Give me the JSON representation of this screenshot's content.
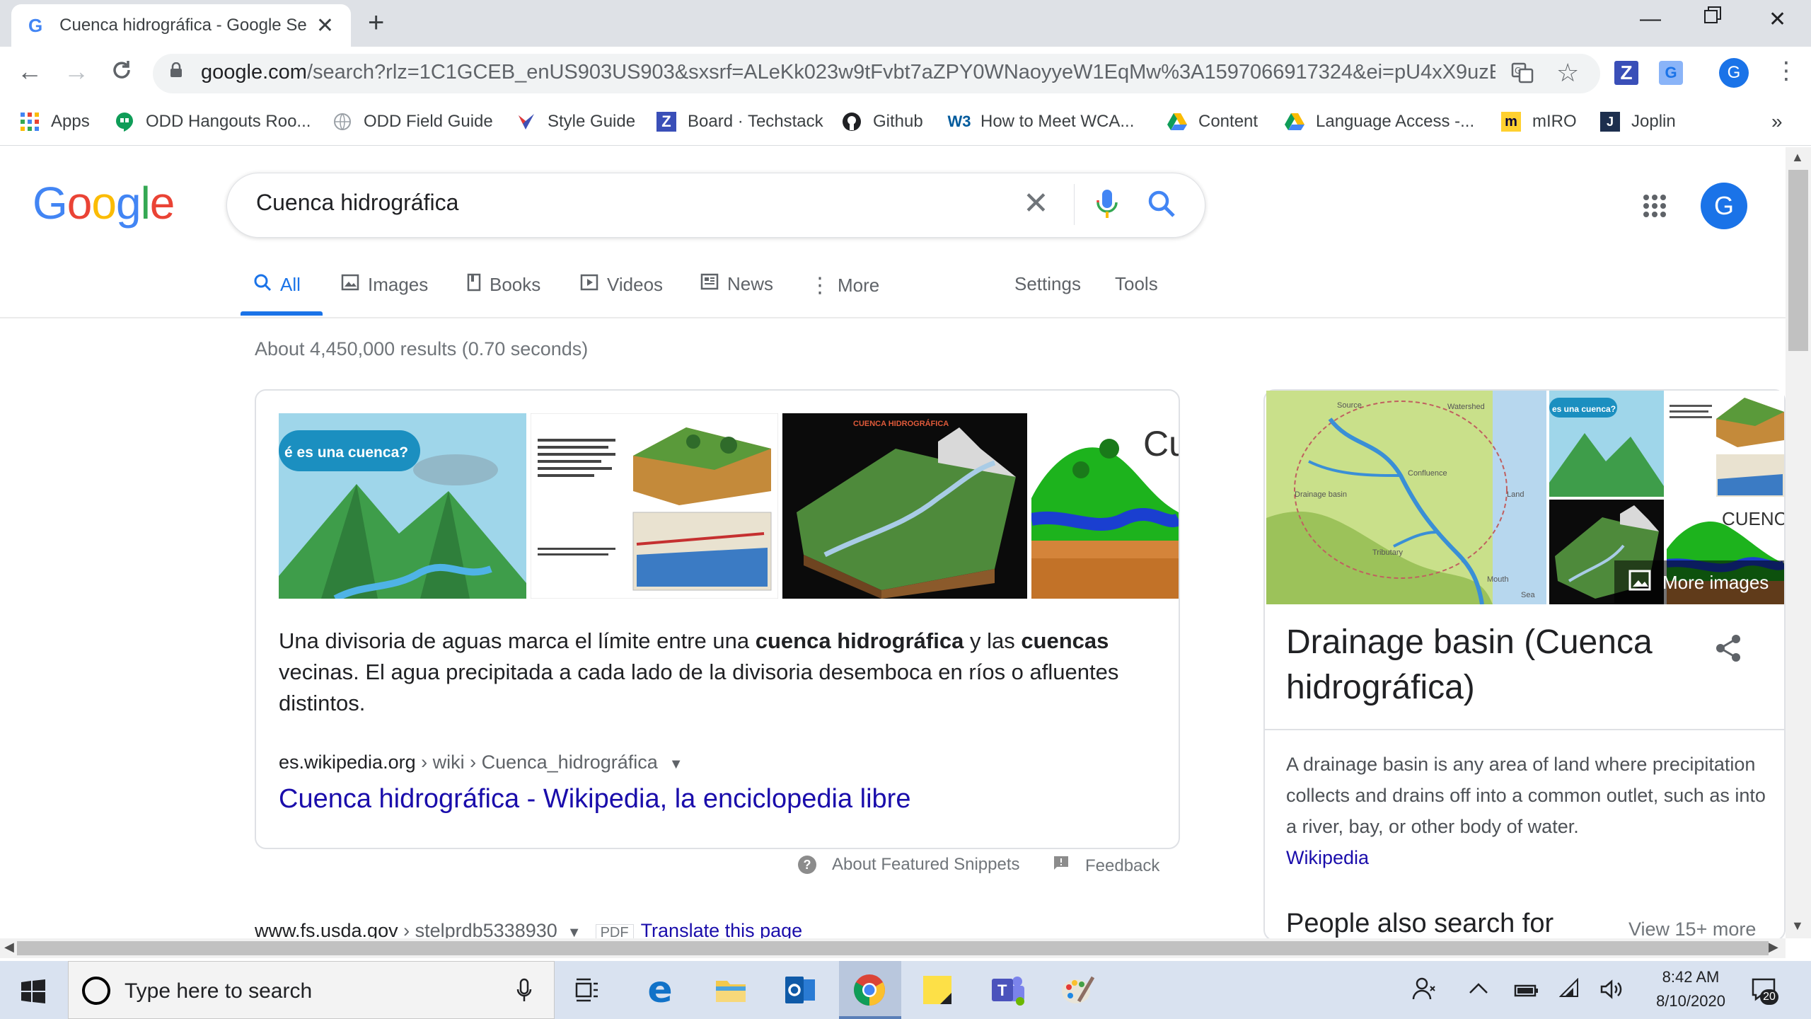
{
  "browser": {
    "tab_title": "Cuenca hidrográfica - Google Se",
    "new_tab": "+",
    "url_domain": "google.com",
    "url_rest": "/search?rlz=1C1GCEB_enUS903US903&sxsrf=ALeKk023w9tFvbt7aZPY0WNaoyyeW1EqMw%3A1597066917324&ei=pU4xX9uzE4O2sw...",
    "profile_initial": "G",
    "ext_z": "Z",
    "ext_g": "G"
  },
  "bookmarks": [
    {
      "label": "Apps",
      "icon": "apps-grid-icon"
    },
    {
      "label": "ODD Hangouts Roo...",
      "icon": "hangouts-icon"
    },
    {
      "label": "ODD Field Guide",
      "icon": "globe-icon"
    },
    {
      "label": "Style Guide",
      "icon": "style-guide-icon"
    },
    {
      "label": "Board · Techstack",
      "icon": "zenhub-icon"
    },
    {
      "label": "Github",
      "icon": "github-icon"
    },
    {
      "label": "How to Meet WCA...",
      "icon": "w3c-icon"
    },
    {
      "label": "Content",
      "icon": "drive-icon"
    },
    {
      "label": "Language Access -...",
      "icon": "drive-icon"
    },
    {
      "label": "mIRO",
      "icon": "miro-icon"
    },
    {
      "label": "Joplin",
      "icon": "joplin-icon"
    }
  ],
  "bookmarks_overflow": "»",
  "search": {
    "logo": [
      "G",
      "o",
      "o",
      "g",
      "l",
      "e"
    ],
    "query": "Cuenca hidrográfica",
    "avatar": "G"
  },
  "tabs": {
    "all": "All",
    "images": "Images",
    "books": "Books",
    "videos": "Videos",
    "news": "News",
    "more": "More",
    "settings": "Settings",
    "tools": "Tools"
  },
  "results_count": "About 4,450,000 results (0.70 seconds)",
  "snippet": {
    "thumb1_text": "é es una cuenca?",
    "thumb3_text": "CUENCA HIDROGRÁFICA",
    "thumb4_text": "Cu",
    "text_parts": [
      "Una divisoria de aguas marca el límite entre una ",
      "cuenca hidrográfica",
      " y las ",
      "cuencas",
      " vecinas. El agua precipitada a cada lado de la divisoria desemboca en ríos o afluentes distintos."
    ],
    "cite_domain": "es.wikipedia.org",
    "cite_path": " › wiki › Cuenca_hidrográfica",
    "title": "Cuenca hidrográfica - Wikipedia, la enciclopedia libre",
    "about": "About Featured Snippets",
    "feedback": "Feedback"
  },
  "next_result": {
    "domain": "www.fs.usda.gov",
    "path": " › stelprdb5338930",
    "pdf": "PDF",
    "translate": "Translate this page"
  },
  "knowledge_panel": {
    "map_labels": {
      "source": "Source",
      "watershed": "Watershed",
      "confluence": "Confluence",
      "drainage": "Drainage basin",
      "land": "Land",
      "tributary": "Tributary",
      "mouth": "Mouth",
      "sea": "Sea"
    },
    "small1_text": "es una cuenca?",
    "small4_text": "CUENCA",
    "more_images": "More images",
    "title": "Drainage basin (Cuenca hidrográfica)",
    "description": "A drainage basin is any area of land where precipitation collects and drains off into a common outlet, such as into a river, bay, or other body of water.",
    "source": "Wikipedia",
    "people_also": "People also search for",
    "view_more": "View 15+ more"
  },
  "taskbar": {
    "search_placeholder": "Type here to search",
    "time": "8:42 AM",
    "date": "8/10/2020",
    "notif_count": "20"
  },
  "colors": {
    "accent": "#1a73e8",
    "link": "#1a0dab",
    "taskbar": "#d9e2f0"
  }
}
